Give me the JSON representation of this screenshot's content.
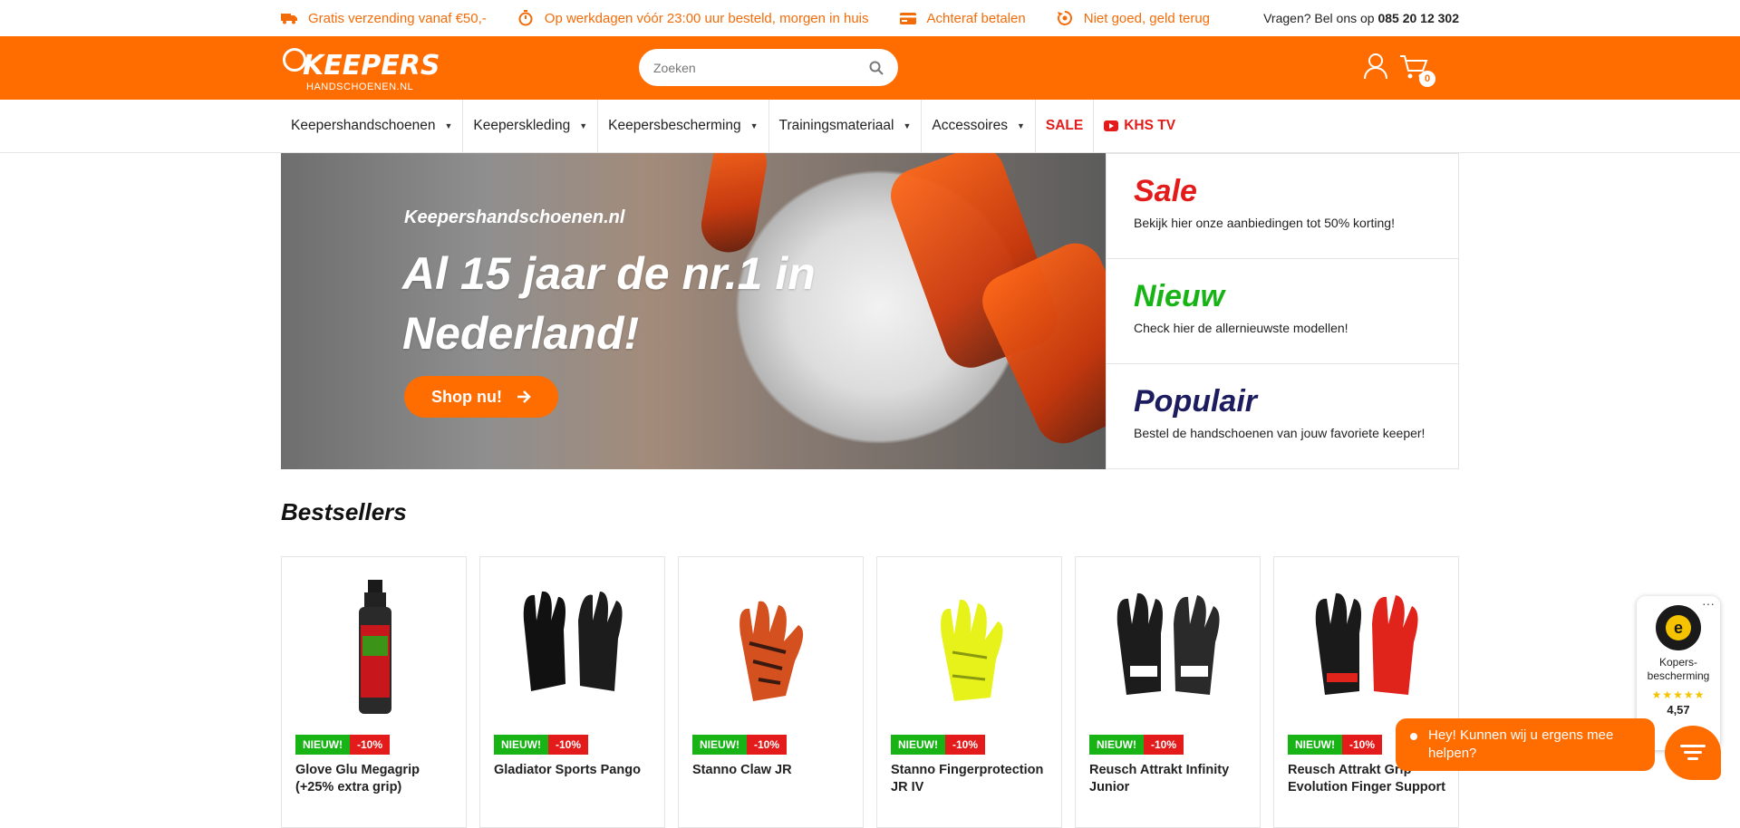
{
  "usp": [
    {
      "icon": "truck-icon",
      "text": "Gratis verzending vanaf €50,-"
    },
    {
      "icon": "stopwatch-icon",
      "text": "Op werkdagen vóór 23:00 uur besteld, morgen in huis"
    },
    {
      "icon": "credit-card-icon",
      "text": "Achteraf betalen"
    },
    {
      "icon": "return-icon",
      "text": "Niet goed, geld terug"
    }
  ],
  "phone": {
    "prefix": "Vragen? Bel ons op",
    "number": "085 20 12 302"
  },
  "logo": {
    "big": "KEEPERS",
    "small": "HANDSCHOENEN.NL"
  },
  "search": {
    "placeholder": "Zoeken"
  },
  "cart": {
    "count": "0"
  },
  "nav": [
    {
      "label": "Keepershandschoenen",
      "caret": true
    },
    {
      "label": "Keeperskleding",
      "caret": true
    },
    {
      "label": "Keepersbescherming",
      "caret": true
    },
    {
      "label": "Trainingsmateriaal",
      "caret": true
    },
    {
      "label": "Accessoires",
      "caret": true
    },
    {
      "label": "SALE"
    },
    {
      "label": "KHS TV"
    }
  ],
  "hero": {
    "brand": "Keepershandschoenen.nl",
    "headline": "Al 15 jaar de nr.1 in Nederland!",
    "cta": "Shop nu!"
  },
  "promos": [
    {
      "title": "Sale",
      "desc": "Bekijk hier onze aanbiedingen tot 50% korting!",
      "color": "#e31b1b"
    },
    {
      "title": "Nieuw",
      "desc": "Check hier de allernieuwste modellen!",
      "color": "#18b416"
    },
    {
      "title": "Populair",
      "desc": "Bestel de handschoenen van jouw favoriete keeper!",
      "color": "#1c1c5e"
    }
  ],
  "bestsellers_title": "Bestsellers",
  "products": [
    {
      "name": "Glove Glu Megagrip (+25% extra grip)",
      "badge_new": "NIEUW!",
      "badge_disc": "-10%",
      "image": "spray-bottle"
    },
    {
      "name": "Gladiator Sports Pango",
      "badge_new": "NIEUW!",
      "badge_disc": "-10%",
      "image": "black-gloves"
    },
    {
      "name": "Stanno Claw JR",
      "badge_new": "NIEUW!",
      "badge_disc": "-10%",
      "image": "orange-glove"
    },
    {
      "name": "Stanno Fingerprotection JR IV",
      "badge_new": "NIEUW!",
      "badge_disc": "-10%",
      "image": "yellow-glove"
    },
    {
      "name": "Reusch Attrakt Infinity Junior",
      "badge_new": "NIEUW!",
      "badge_disc": "-10%",
      "image": "black-white-gloves"
    },
    {
      "name": "Reusch Attrakt Grip Evolution Finger Support",
      "badge_new": "NIEUW!",
      "badge_disc": "-10%",
      "image": "red-black-gloves"
    }
  ],
  "trust": {
    "label": "Kopers-bescherming",
    "stars": "★★★★★",
    "score": "4,57",
    "more": "···"
  },
  "chat": {
    "text": "Hey! Kunnen wij u ergens mee helpen?"
  },
  "colors": {
    "brand": "#ff6c00",
    "sale": "#e31b1b",
    "new": "#18b416",
    "popular": "#1c1c5e"
  }
}
